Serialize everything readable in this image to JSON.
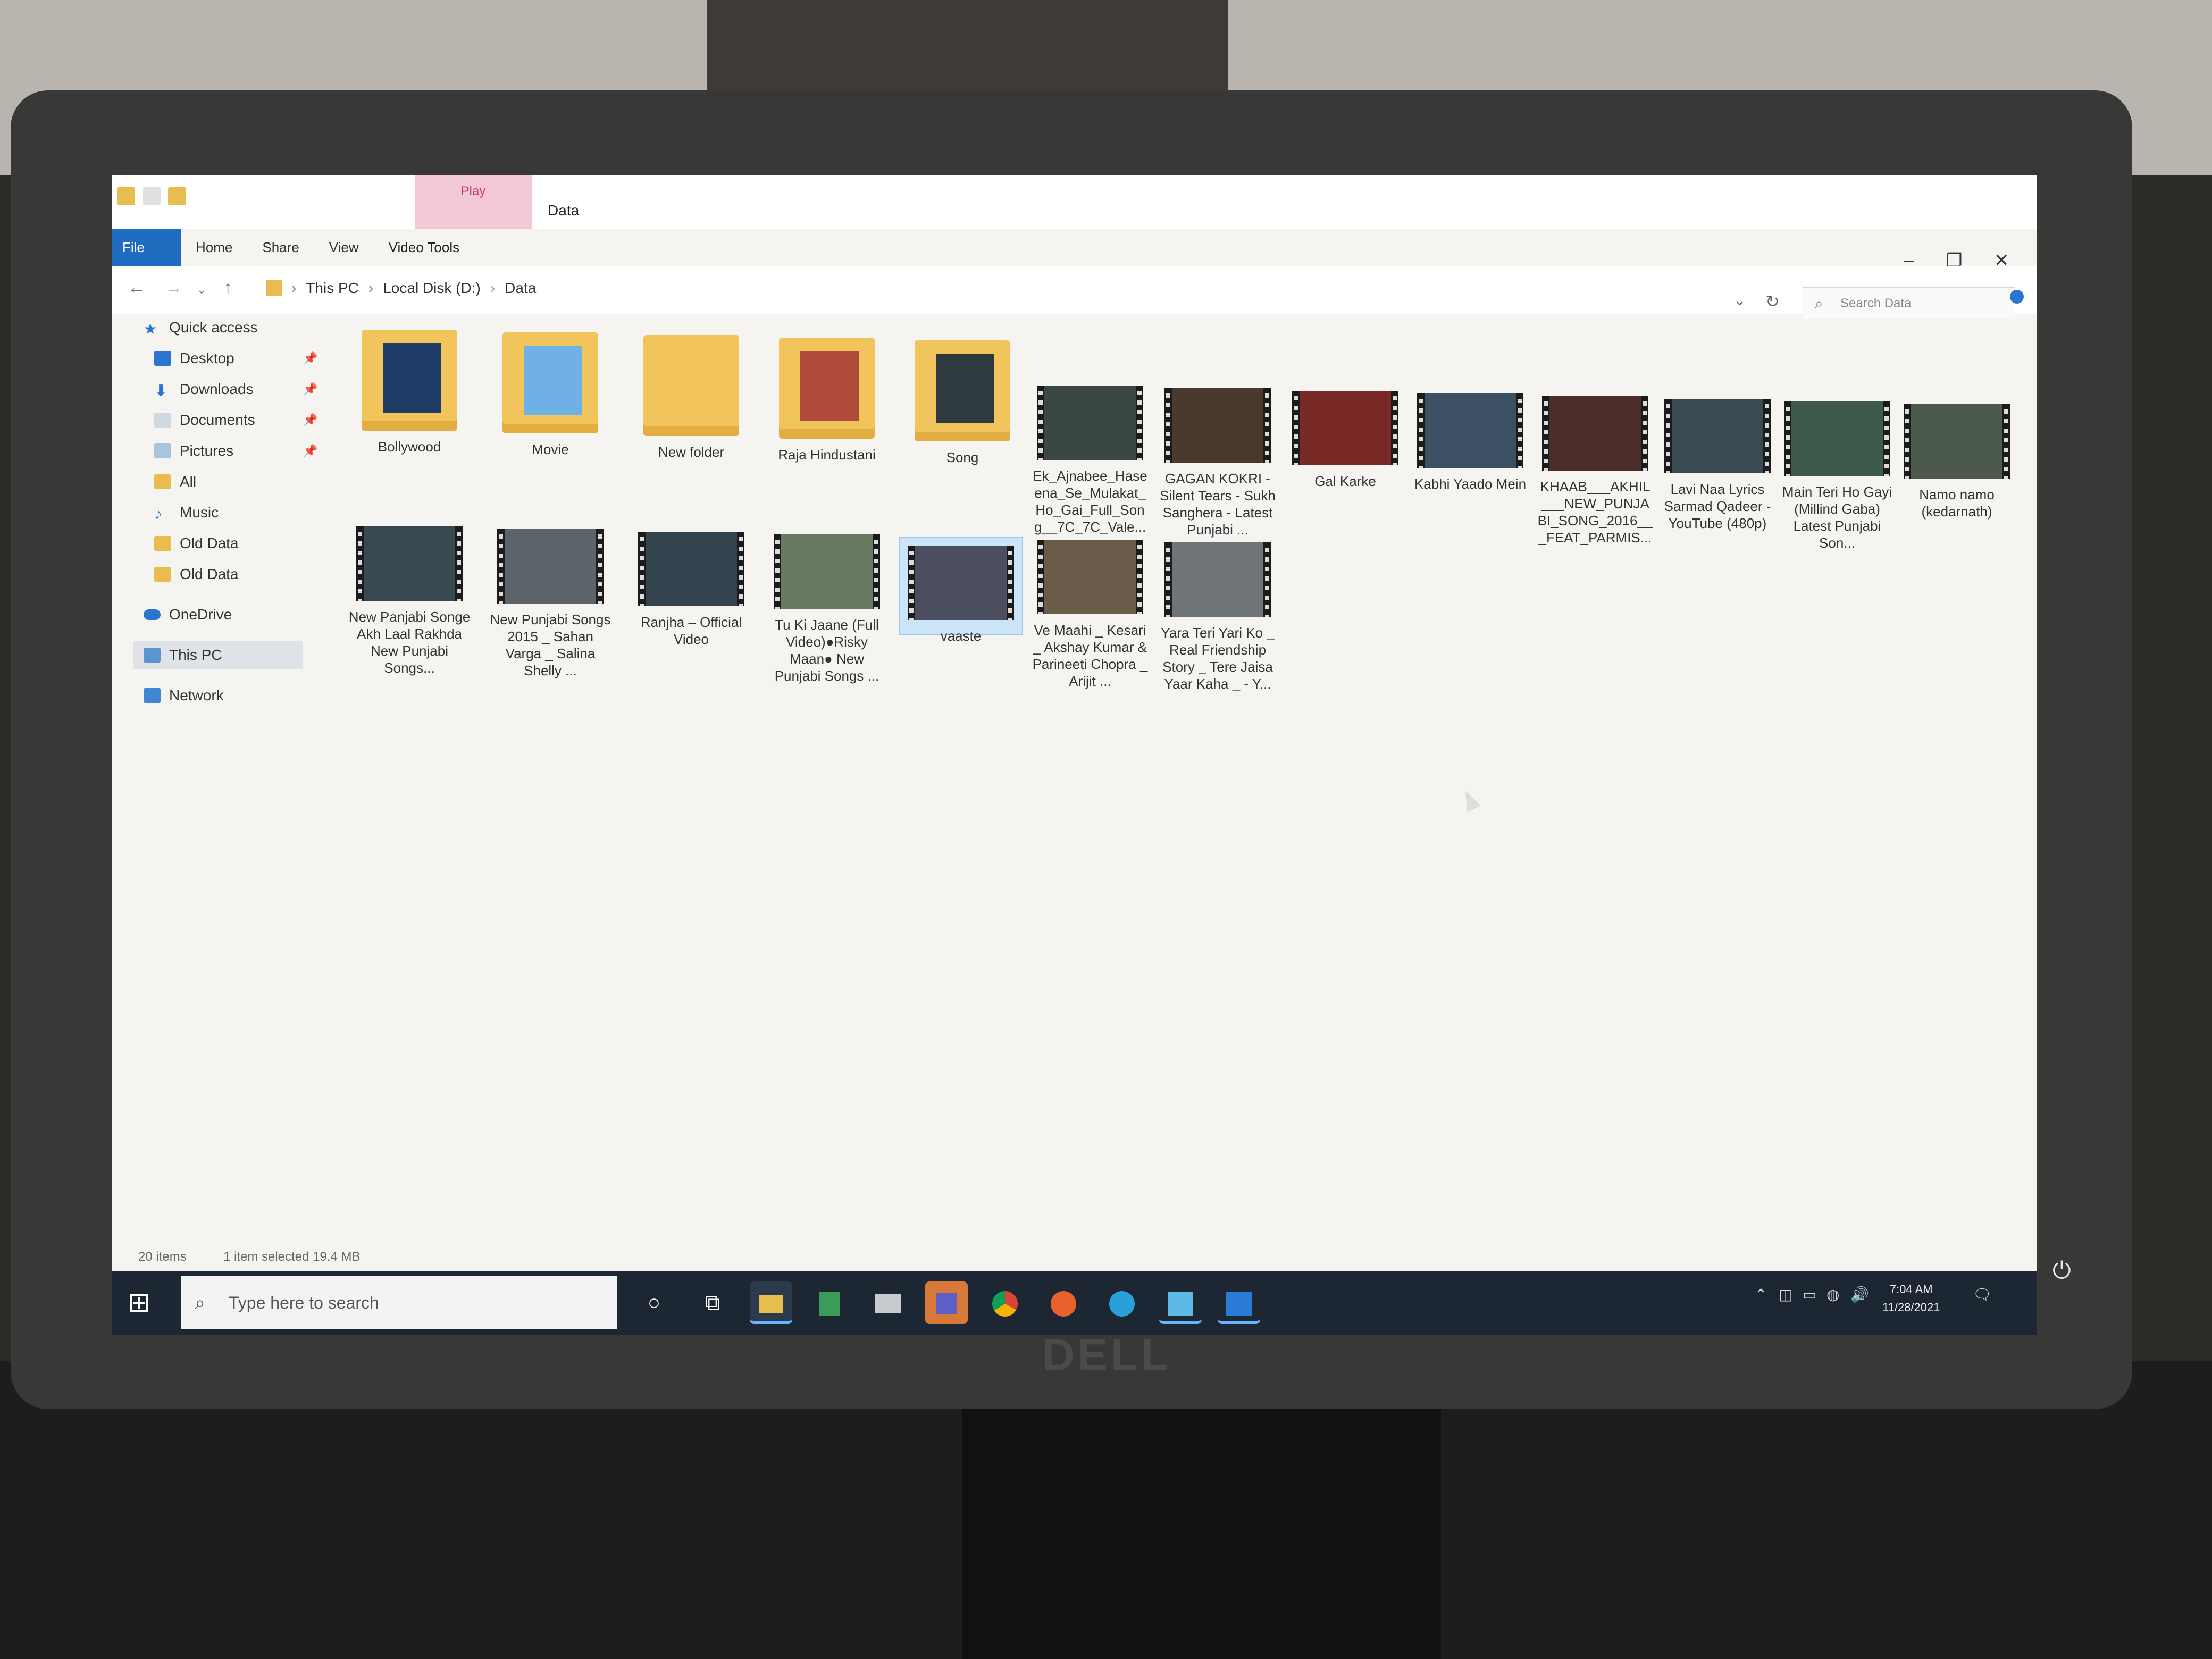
{
  "window": {
    "title": "Data",
    "context_tab_group": "Play",
    "tabs": [
      "File",
      "Home",
      "Share",
      "View",
      "Video Tools"
    ]
  },
  "breadcrumb": [
    "This PC",
    "Local Disk (D:)",
    "Data"
  ],
  "search": {
    "placeholder": "Search Data"
  },
  "sidebar": {
    "items": [
      {
        "label": "Quick access",
        "icon": "star-icon"
      },
      {
        "label": "Desktop",
        "icon": "desktop-icon",
        "pinned": true
      },
      {
        "label": "Downloads",
        "icon": "download-icon",
        "pinned": true
      },
      {
        "label": "Documents",
        "icon": "documents-icon",
        "pinned": true
      },
      {
        "label": "Pictures",
        "icon": "pictures-icon",
        "pinned": true
      },
      {
        "label": "All",
        "icon": "folder-icon"
      },
      {
        "label": "Music",
        "icon": "music-icon"
      },
      {
        "label": "Old Data",
        "icon": "folder-icon"
      },
      {
        "label": "Old Data",
        "icon": "folder-icon"
      },
      {
        "label": "OneDrive",
        "icon": "cloud-icon"
      },
      {
        "label": "This PC",
        "icon": "computer-icon",
        "selected": true
      },
      {
        "label": "Network",
        "icon": "network-icon"
      }
    ]
  },
  "files": [
    {
      "name": "Bollywood",
      "type": "folder"
    },
    {
      "name": "Movie",
      "type": "folder"
    },
    {
      "name": "New folder",
      "type": "folder"
    },
    {
      "name": "Raja Hindustani",
      "type": "folder"
    },
    {
      "name": "Song",
      "type": "folder"
    },
    {
      "name": "Ek_Ajnabee_Hase ena_Se_Mulakat_ Ho_Gai_Full_Son g__7C_7C_Vale...",
      "type": "video"
    },
    {
      "name": "GAGAN KOKRI - Silent Tears - Sukh Sanghera - Latest Punjabi ...",
      "type": "video"
    },
    {
      "name": "Gal Karke",
      "type": "video"
    },
    {
      "name": "Kabhi Yaado Mein",
      "type": "video"
    },
    {
      "name": "KHAAB___AKHIL ___NEW_PUNJA BI_SONG_2016__ _FEAT_PARMIS...",
      "type": "video"
    },
    {
      "name": "Lavi Naa Lyrics Sarmad Qadeer - YouTube (480p)",
      "type": "video"
    },
    {
      "name": "Main Teri Ho Gayi (Millind Gaba) Latest Punjabi Son...",
      "type": "video"
    },
    {
      "name": "Namo namo (kedarnath)",
      "type": "video"
    },
    {
      "name": "New Panjabi Songe Akh Laal Rakhda New Punjabi Songs...",
      "type": "video"
    },
    {
      "name": "New Punjabi Songs 2015 _ Sahan Varga _ Salina Shelly ...",
      "type": "video"
    },
    {
      "name": "Ranjha – Official Video",
      "type": "video"
    },
    {
      "name": "Tu Ki Jaane (Full Video)●Risky Maan● New Punjabi Songs ...",
      "type": "video"
    },
    {
      "name": "vaaste",
      "type": "video",
      "selected": true
    },
    {
      "name": "Ve Maahi _ Kesari _ Akshay Kumar & Parineeti Chopra _ Arijit ...",
      "type": "video"
    },
    {
      "name": "Yara Teri Yari Ko _ Real Friendship Story _ Tere Jaisa Yaar Kaha _ - Y...",
      "type": "video"
    }
  ],
  "status": {
    "item_count": "20 items",
    "selection": "1 item selected  19.4 MB"
  },
  "taskbar": {
    "search_placeholder": "Type here to search",
    "time": "7:04 AM",
    "date": "11/28/2021"
  },
  "hardware": {
    "brand": "DELL"
  }
}
